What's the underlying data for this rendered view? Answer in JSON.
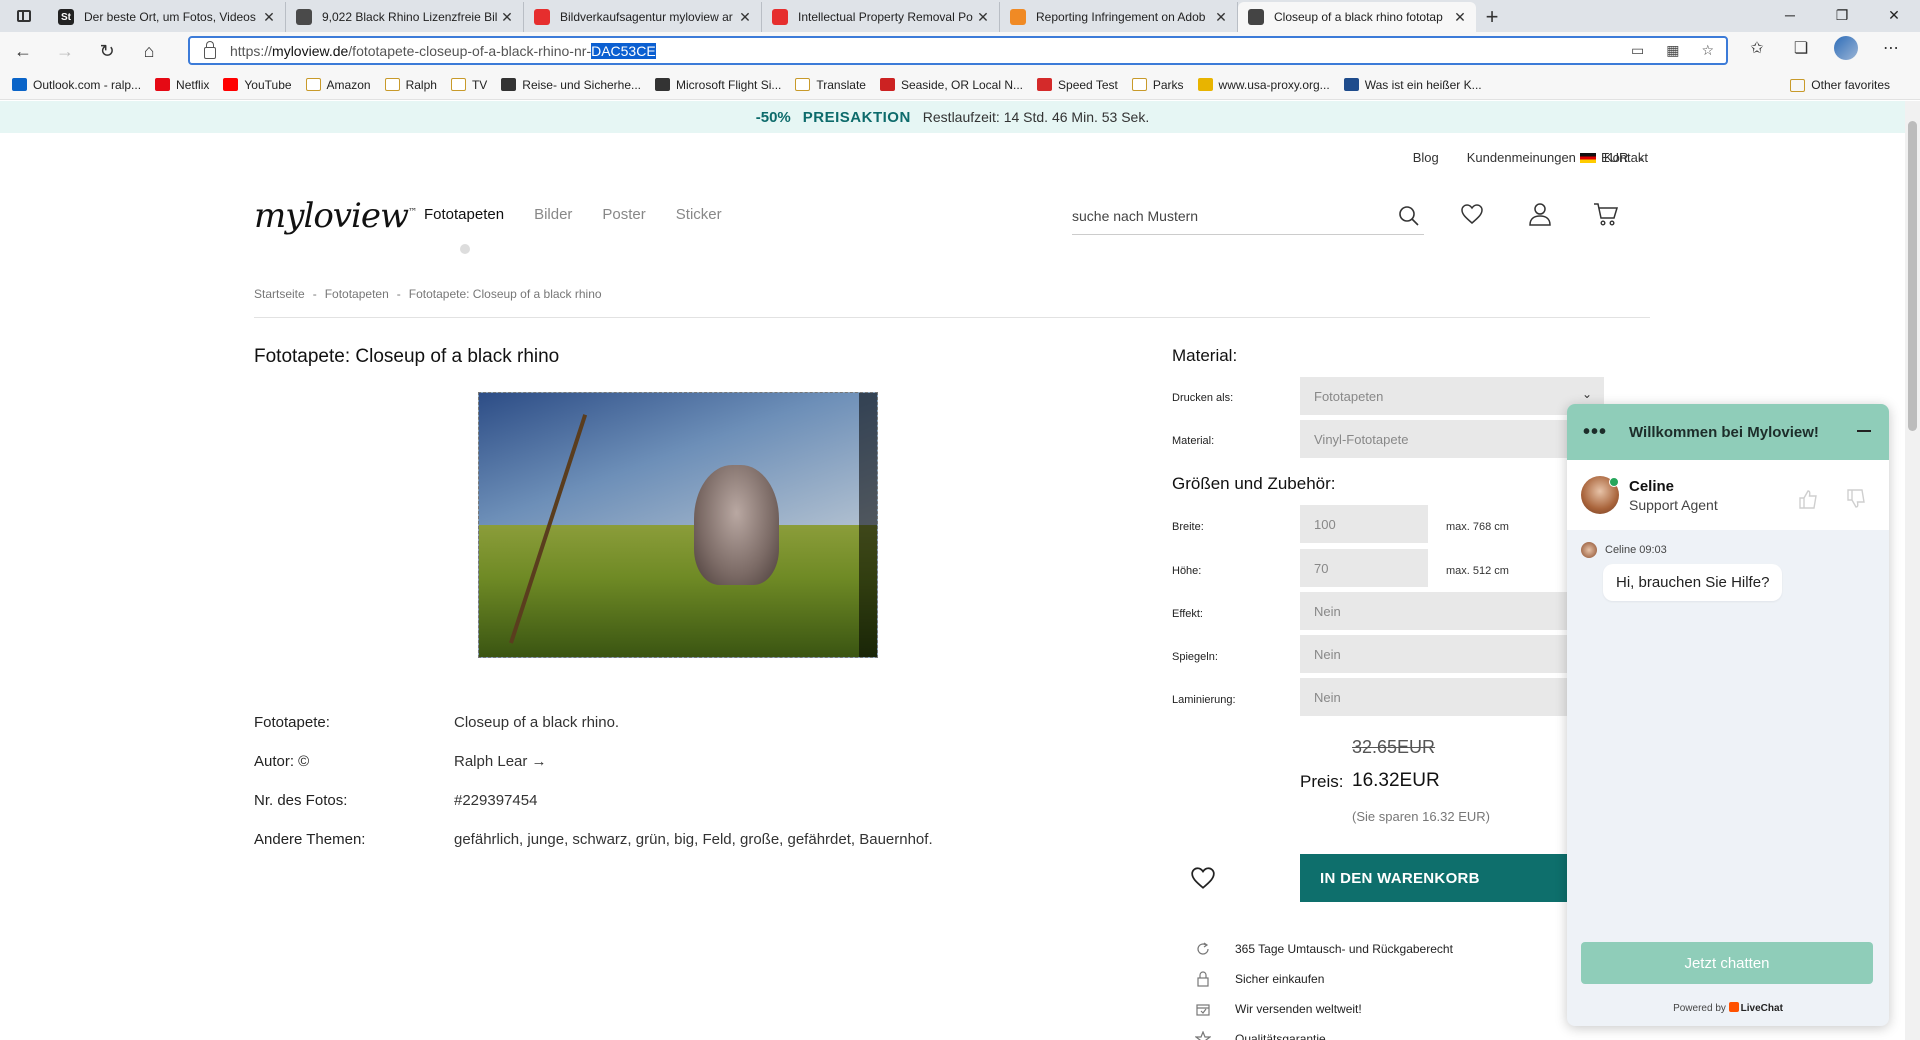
{
  "browser": {
    "tabs": [
      {
        "title": "Der beste Ort, um Fotos, Videos",
        "favicon": "St",
        "color": "#222222"
      },
      {
        "title": "9,022 Black Rhino Lizenzfreie Bil",
        "favicon": "",
        "color": "#4a4a4a"
      },
      {
        "title": "Bildverkaufsagentur myloview ar",
        "favicon": "",
        "color": "#e62e2e"
      },
      {
        "title": "Intellectual Property Removal Po",
        "favicon": "",
        "color": "#e62e2e"
      },
      {
        "title": "Reporting Infringement on Adob",
        "favicon": "",
        "color": "#f08a24"
      },
      {
        "title": "Closeup of a black rhino fototap",
        "favicon": "",
        "color": "#444444"
      }
    ],
    "url": {
      "prefix": "https://",
      "host": "myloview.de",
      "path": "/fototapete-closeup-of-a-black-rhino-nr-",
      "selected": "DAC53CE"
    },
    "bookmarks": [
      {
        "label": "Outlook.com - ralp...",
        "icon": "outlook-icon",
        "color": "#0a64c8"
      },
      {
        "label": "Netflix",
        "icon": "netflix-icon",
        "color": "#e50914"
      },
      {
        "label": "YouTube",
        "icon": "youtube-icon",
        "color": "#ff0000"
      },
      {
        "label": "Amazon",
        "icon": "folder-icon",
        "color": ""
      },
      {
        "label": "Ralph",
        "icon": "folder-icon",
        "color": ""
      },
      {
        "label": "TV",
        "icon": "folder-icon",
        "color": ""
      },
      {
        "label": "Reise- und Sicherhe...",
        "icon": "travel-icon",
        "color": "#333333"
      },
      {
        "label": "Microsoft Flight Si...",
        "icon": "flight-icon",
        "color": "#333333"
      },
      {
        "label": "Translate",
        "icon": "folder-icon",
        "color": ""
      },
      {
        "label": "Seaside, OR Local N...",
        "icon": "news-icon",
        "color": "#cc2222"
      },
      {
        "label": "Speed Test",
        "icon": "speedtest-icon",
        "color": "#d42a2a"
      },
      {
        "label": "Parks",
        "icon": "folder-icon",
        "color": ""
      },
      {
        "label": "www.usa-proxy.org...",
        "icon": "star-icon",
        "color": "#e8b400"
      },
      {
        "label": "Was ist ein heißer K...",
        "icon": "site-icon",
        "color": "#1f4c8c"
      }
    ],
    "other_favorites": "Other favorites"
  },
  "promo": {
    "percent": "-50%",
    "label": "PREISAKTION",
    "remaining": "Restlaufzeit:  14 Std. 46 Min. 53 Sek."
  },
  "header": {
    "toplinks": [
      "Blog",
      "Kundenmeinungen",
      "Kontakt"
    ],
    "currency": "EUR",
    "logo": "myloview",
    "logo_tm": "™",
    "nav": [
      "Fototapeten",
      "Bilder",
      "Poster",
      "Sticker"
    ],
    "search_placeholder": "suche nach Mustern"
  },
  "breadcrumb": [
    "Startseite",
    "-",
    "Fototapeten",
    "-",
    "Fototapete: Closeup of a black rhino"
  ],
  "product": {
    "title": "Fototapete: Closeup of a black rhino",
    "details": [
      {
        "k": "Fototapete:",
        "v": "Closeup of a black rhino."
      },
      {
        "k": "Autor: ©",
        "v": "Ralph Lear  →"
      },
      {
        "k": "Nr. des Fotos:",
        "v": "#229397454"
      },
      {
        "k": "Andere Themen:",
        "v": "gefährlich, junge, schwarz, grün, big, Feld, große, gefährdet, Bauernhof."
      }
    ]
  },
  "config": {
    "material_heading": "Material:",
    "print_label": "Drucken als:",
    "print_value": "Fototapeten",
    "material_label": "Material:",
    "material_value": "Vinyl-Fototapete",
    "size_heading": "Größen und Zubehör:",
    "width_label": "Breite:",
    "width_value": "100",
    "width_max": "max. 768 cm",
    "height_label": "Höhe:",
    "height_value": "70",
    "height_max": "max. 512 cm",
    "effect_label": "Effekt:",
    "effect_value": "Nein",
    "mirror_label": "Spiegeln:",
    "mirror_value": "Nein",
    "lamination_label": "Laminierung:",
    "lamination_value": "Nein"
  },
  "pricing": {
    "old_price": "32.65EUR",
    "price_label": "Preis:",
    "price": "16.32EUR",
    "savings": "(Sie sparen 16.32 EUR)",
    "cart_button": "IN DEN WARENKORB"
  },
  "usps": [
    "365 Tage Umtausch- und Rückgaberecht",
    "Sicher einkaufen",
    "Wir versenden weltweit!",
    "Qualitätsgarantie"
  ],
  "chat": {
    "title": "Willkommen bei Myloview!",
    "agent_name": "Celine",
    "agent_role": "Support Agent",
    "msg_meta": "Celine 09:03",
    "message": "Hi, brauchen Sie Hilfe?",
    "button": "Jetzt chatten",
    "powered_by": "Powered by",
    "brand": "LiveChat"
  }
}
